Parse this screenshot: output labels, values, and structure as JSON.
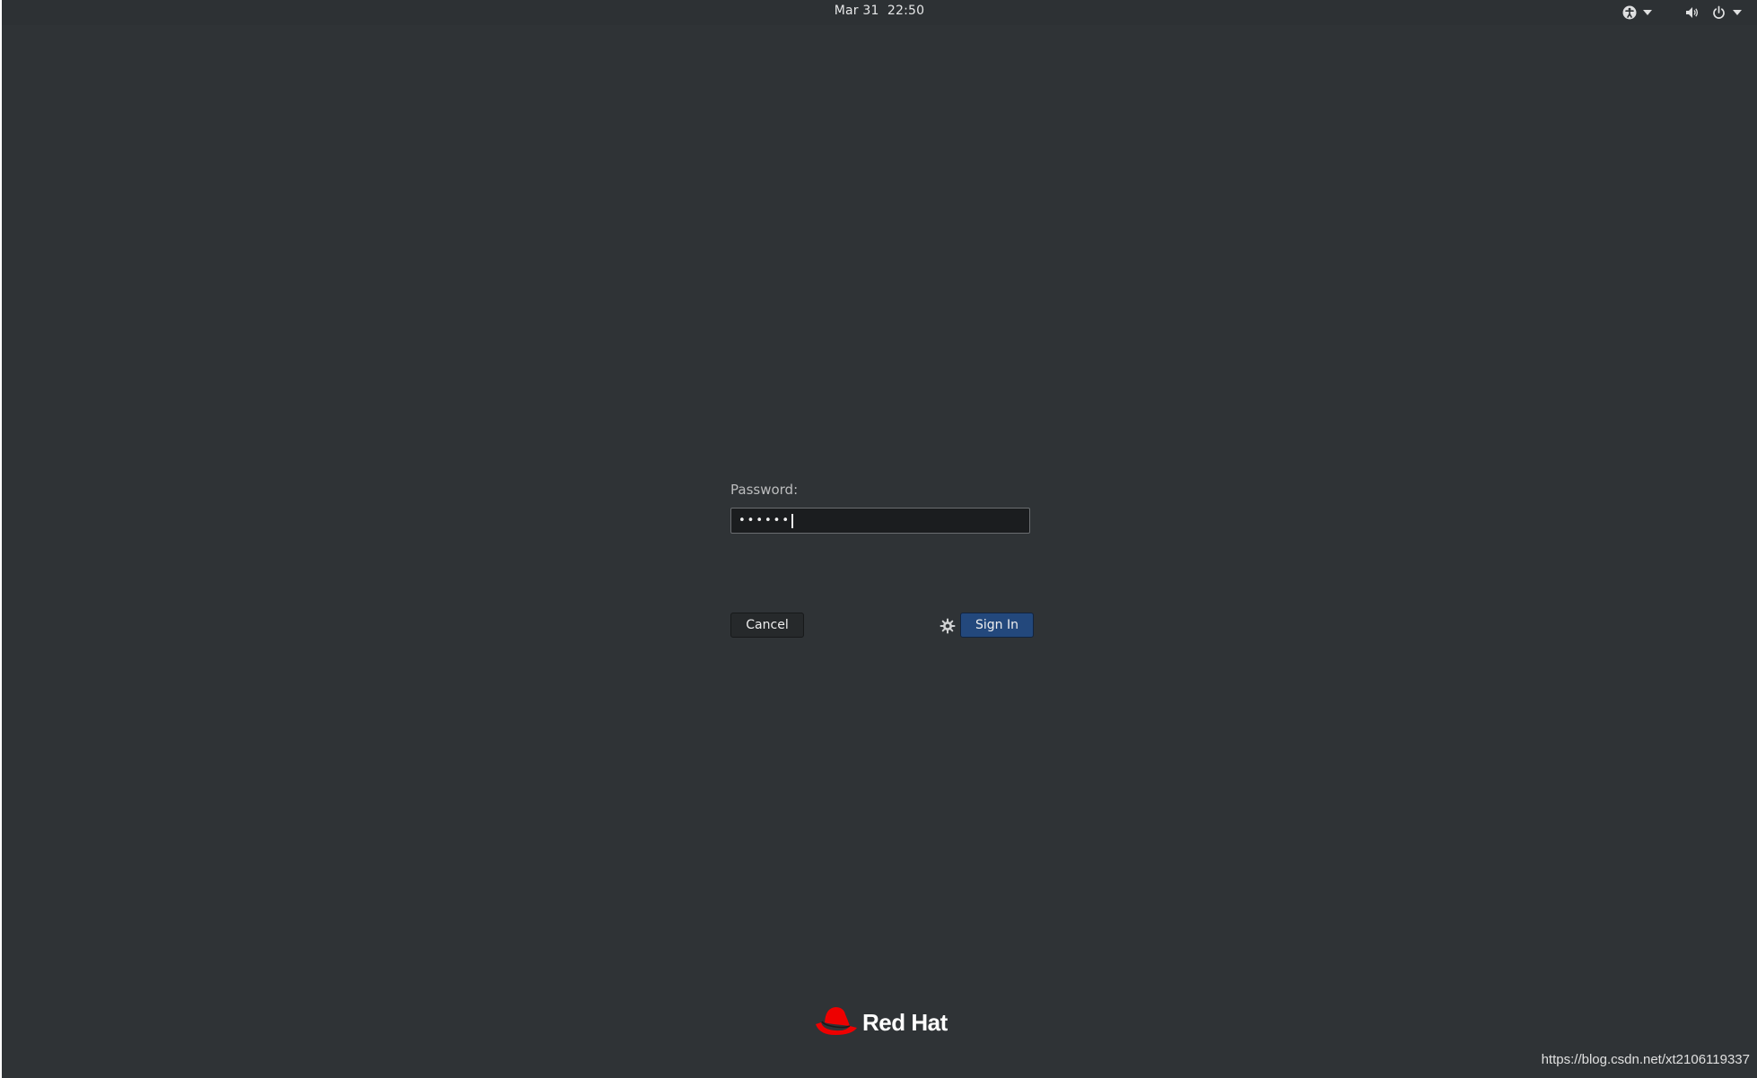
{
  "topbar": {
    "clock": "Mar 31  22:50",
    "icons": [
      "accessibility-icon",
      "dropdown-arrow-icon",
      "volume-icon",
      "power-icon",
      "dropdown-arrow-icon"
    ]
  },
  "login": {
    "password_label": "Password:",
    "password_value": "••••••",
    "cancel_label": "Cancel",
    "sign_in_label": "Sign In",
    "session_icon": "gear-icon"
  },
  "branding": {
    "logo_text": "Red Hat",
    "logo_color": "#ee0000"
  },
  "watermark": "https://blog.csdn.net/xt2106119337",
  "colors": {
    "background": "#2f3336",
    "accent": "#23487c"
  }
}
